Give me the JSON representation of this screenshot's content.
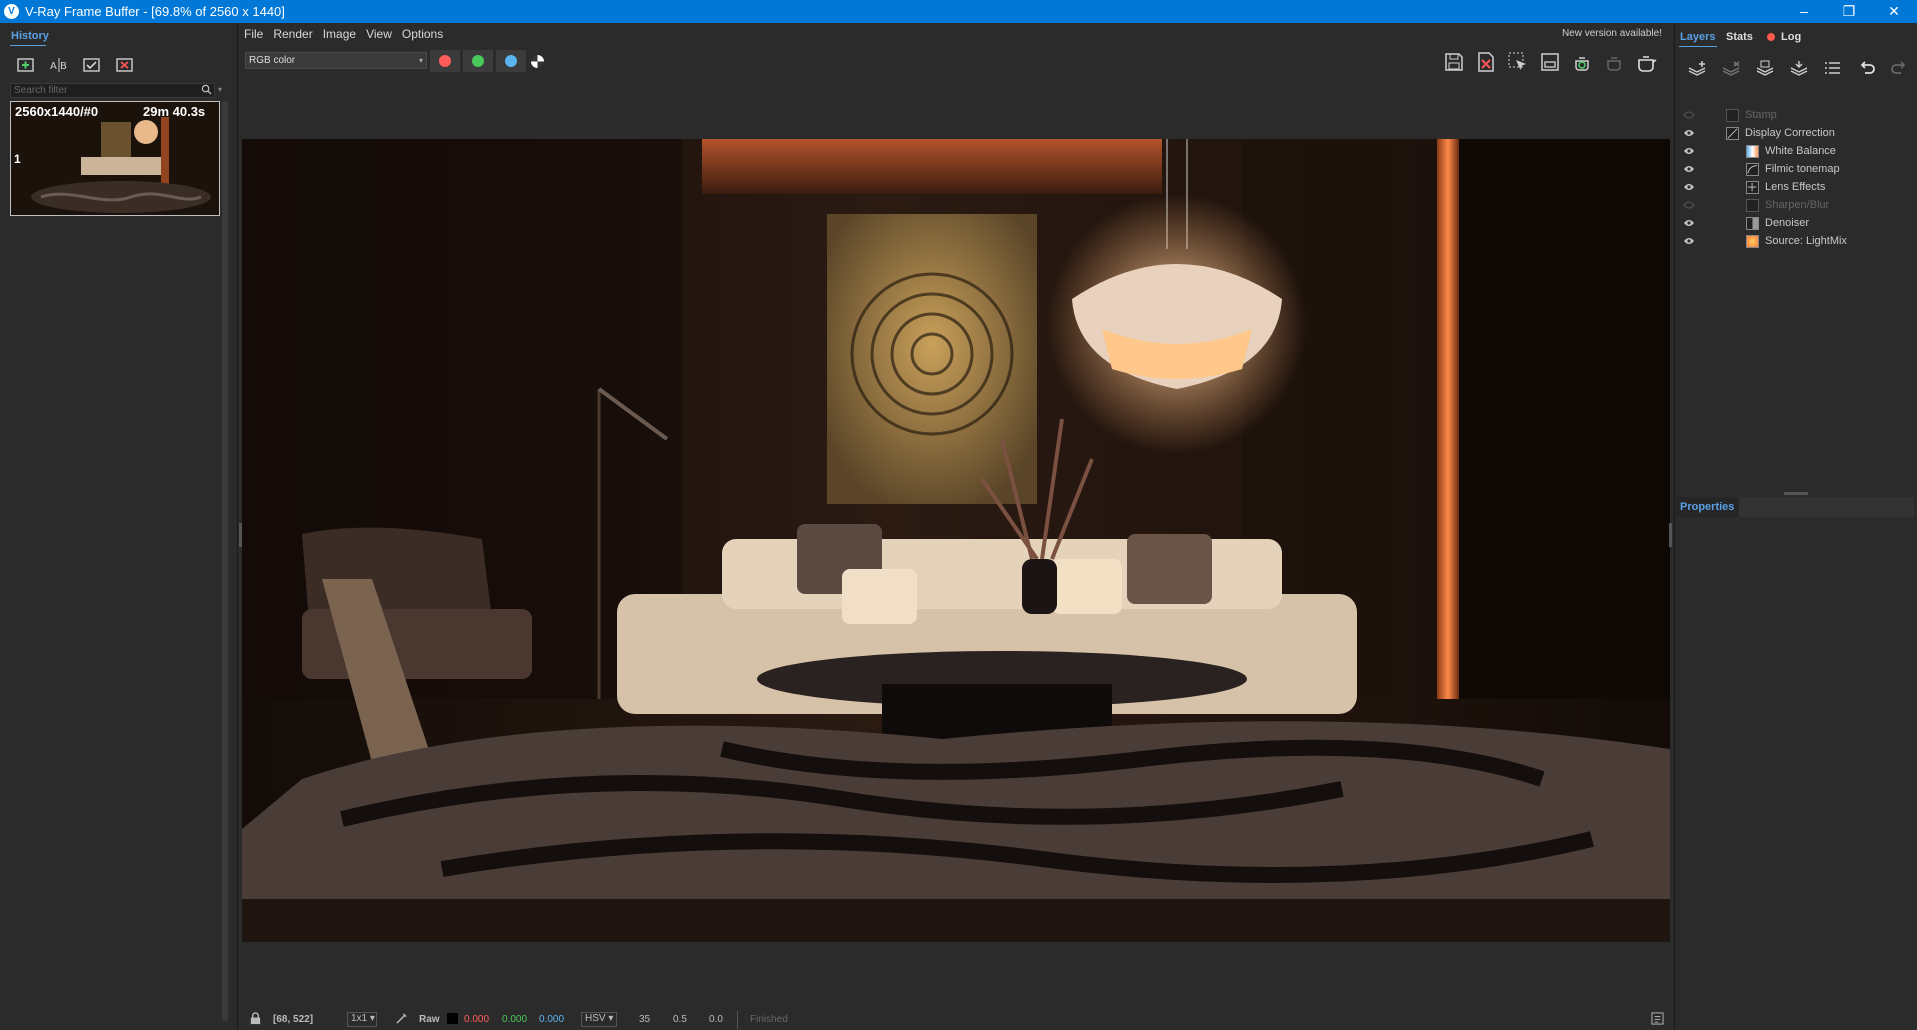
{
  "window": {
    "title": "V-Ray Frame Buffer - [69.8% of 2560 x 1440]",
    "app_icon": "V",
    "controls": {
      "minimize": "–",
      "maximize": "❐",
      "close": "✕"
    }
  },
  "history": {
    "tab_label": "History",
    "search_placeholder": "Search filter",
    "entry": {
      "resolution": "2560x1440/#0",
      "time": "29m 40.3s",
      "index": "1"
    }
  },
  "menu": {
    "items": [
      "File",
      "Render",
      "Image",
      "View",
      "Options"
    ],
    "notice": "New version available!"
  },
  "toolbar": {
    "channel": "RGB color"
  },
  "status": {
    "coords": "[68, 522]",
    "zoom": "1x1",
    "mode": "Raw",
    "r": "0.000",
    "g": "0.000",
    "b": "0.000",
    "color_space": "HSV",
    "h": "35",
    "s": "0.5",
    "v": "0.0",
    "state": "Finished"
  },
  "right_panel": {
    "tabs": {
      "layers": "Layers",
      "stats": "Stats",
      "log": "Log"
    },
    "layers": [
      {
        "label": "Stamp",
        "visible": false,
        "dimmed": true
      },
      {
        "label": "Display Correction",
        "visible": true,
        "dimmed": false
      },
      {
        "label": "White Balance",
        "visible": true,
        "dimmed": false
      },
      {
        "label": "Filmic tonemap",
        "visible": true,
        "dimmed": false
      },
      {
        "label": "Lens Effects",
        "visible": true,
        "dimmed": false
      },
      {
        "label": "Sharpen/Blur",
        "visible": false,
        "dimmed": true
      },
      {
        "label": "Denoiser",
        "visible": true,
        "dimmed": false
      },
      {
        "label": "Source: LightMix",
        "visible": true,
        "dimmed": false
      }
    ],
    "properties_label": "Properties"
  },
  "colors": {
    "titlebar": "#0078d7",
    "accent_tab": "#5aa0e6",
    "red_channel": "#ff5b5b",
    "green_channel": "#48c85a",
    "blue_channel": "#5ab4f0",
    "log_dot": "#ff5a4a"
  }
}
